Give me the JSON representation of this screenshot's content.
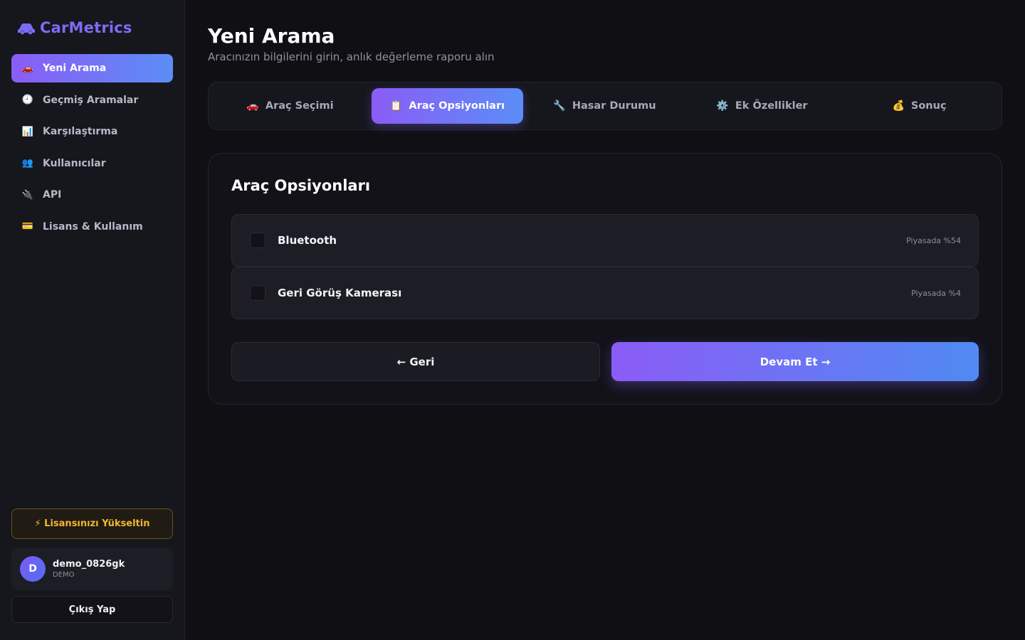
{
  "app": {
    "name": "CarMetrics",
    "brand_color": "#7b6cf6",
    "accent_gradient": [
      "#8b5cf6",
      "#5b8df6"
    ]
  },
  "sidebar": {
    "items": [
      {
        "icon": "car-icon",
        "glyph": "🚗",
        "label": "Yeni Arama",
        "active": true
      },
      {
        "icon": "clock-icon",
        "glyph": "🕘",
        "label": "Geçmiş Aramalar",
        "active": false
      },
      {
        "icon": "bar-chart-icon",
        "glyph": "📊",
        "label": "Karşılaştırma",
        "active": false
      },
      {
        "icon": "users-icon",
        "glyph": "👥",
        "label": "Kullanıcılar",
        "active": false
      },
      {
        "icon": "plug-icon",
        "glyph": "🔌",
        "label": "API",
        "active": false
      },
      {
        "icon": "credit-card-icon",
        "glyph": "💳",
        "label": "Lisans & Kullanım",
        "active": false
      }
    ],
    "upgrade_label": "⚡ Lisansınızı Yükseltin",
    "user": {
      "initial": "D",
      "name": "demo_0826gk",
      "role": "DEMO"
    },
    "logout_label": "Çıkış Yap"
  },
  "header": {
    "title": "Yeni Arama",
    "subtitle": "Aracınızın bilgilerini girin, anlık değerleme raporu alın"
  },
  "steps": [
    {
      "icon": "car-icon",
      "glyph": "🚗",
      "label": "Araç Seçimi",
      "active": false
    },
    {
      "icon": "clipboard-icon",
      "glyph": "📋",
      "label": "Araç Opsiyonları",
      "active": true
    },
    {
      "icon": "wrench-icon",
      "glyph": "🔧",
      "label": "Hasar Durumu",
      "active": false
    },
    {
      "icon": "gear-icon",
      "glyph": "⚙️",
      "label": "Ek Özellikler",
      "active": false
    },
    {
      "icon": "money-bag-icon",
      "glyph": "💰",
      "label": "Sonuç",
      "active": false
    }
  ],
  "card": {
    "title": "Araç Opsiyonları",
    "options": [
      {
        "label": "Bluetooth",
        "market": "Piyasada %54",
        "checked": false
      },
      {
        "label": "Geri Görüş Kamerası",
        "market": "Piyasada %4",
        "checked": false
      }
    ],
    "back_label": "← Geri",
    "next_label": "Devam Et →"
  }
}
